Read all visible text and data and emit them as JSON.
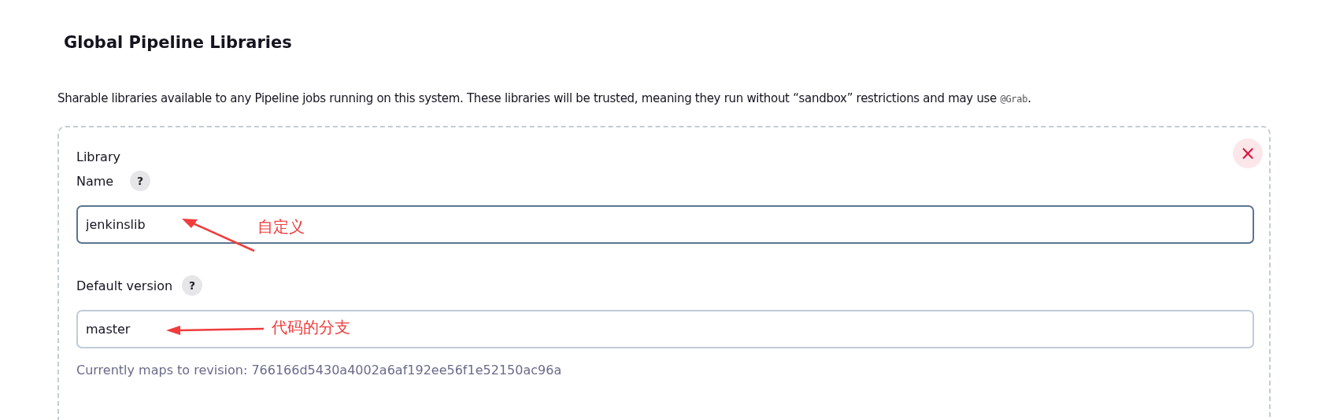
{
  "title": "Global Pipeline Libraries",
  "description": "Sharable libraries available to any Pipeline jobs running on this system. These libraries will be trusted, meaning they run without “sandbox” restrictions and may use ",
  "description_code": "@Grab",
  "description_end": ".",
  "library": {
    "close_button": "×",
    "fields": [
      {
        "label_lines": [
          "Library",
          "Name"
        ],
        "help": "?",
        "value": "jenkinslib",
        "focused": true,
        "annotation": "自定义",
        "kind": "diagonal"
      },
      {
        "label_lines": [
          "Default version"
        ],
        "help": "?",
        "value": "master",
        "focused": false,
        "annotation": "代码的分支",
        "kind": "flat",
        "hint": "Currently maps to revision: 766166d5430a4002a6af192ee56f1e52150ac96a"
      }
    ]
  }
}
